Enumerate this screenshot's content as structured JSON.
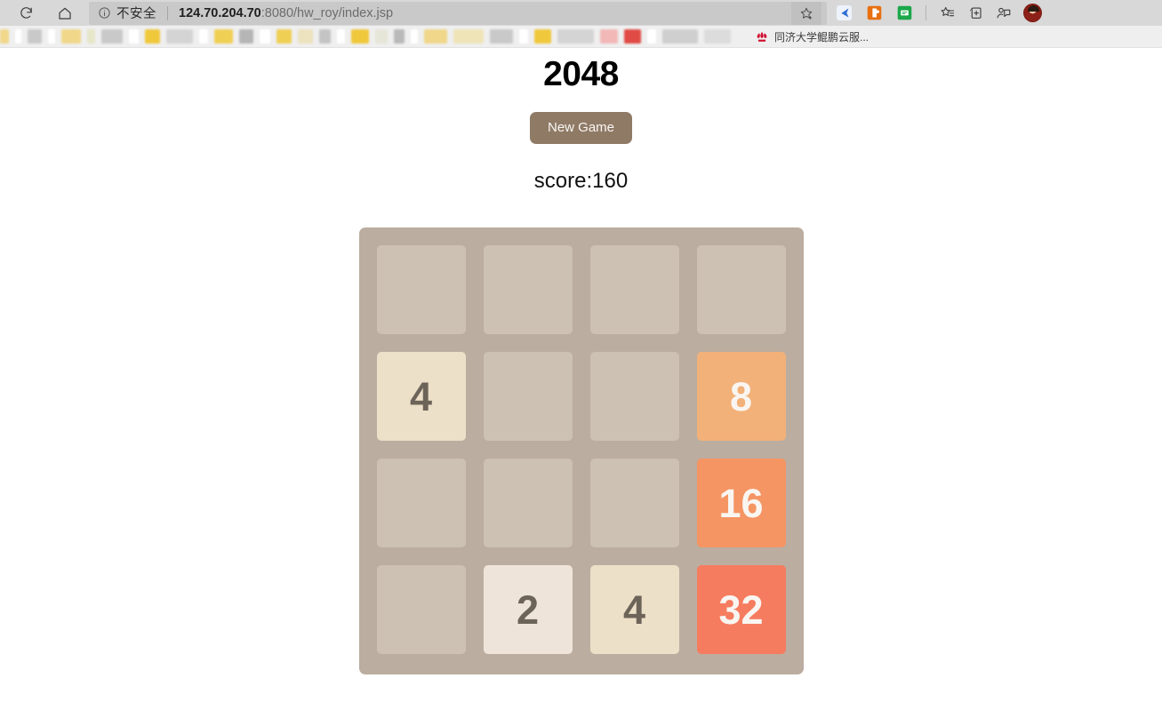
{
  "browser": {
    "reload_icon": "reload-icon",
    "home_icon": "home-icon",
    "info_icon": "info-circle-icon",
    "security_label": "不安全",
    "url_host": "124.70.204.70",
    "url_path": ":8080/hw_roy/index.jsp",
    "star_icon": "favorite-star-icon",
    "extensions": [
      {
        "name": "extension-blue-arrow",
        "color": "#2f6fd0",
        "bg": "#eef2fb"
      },
      {
        "name": "extension-orange-office",
        "color": "#e8700f",
        "bg": "#ffffff"
      },
      {
        "name": "extension-green-note",
        "color": "#1aa84a",
        "bg": "#ffffff"
      }
    ],
    "toolbar_icons": [
      {
        "name": "favorites-list-icon"
      },
      {
        "name": "collections-icon"
      },
      {
        "name": "feedback-icon"
      }
    ],
    "avatar_name": "profile-avatar"
  },
  "bookmarks": {
    "redacted": [
      {
        "w": 10,
        "c": "#f0d78a"
      },
      {
        "w": 7,
        "c": "#ffffff"
      },
      {
        "w": 16,
        "c": "#c9c9c9"
      },
      {
        "w": 8,
        "c": "#ffffff"
      },
      {
        "w": 22,
        "c": "#f0d78a"
      },
      {
        "w": 9,
        "c": "#e6e6c9"
      },
      {
        "w": 24,
        "c": "#c9c9c9"
      },
      {
        "w": 11,
        "c": "#ffffff"
      },
      {
        "w": 17,
        "c": "#f0c83c"
      },
      {
        "w": 30,
        "c": "#d4d4d4"
      },
      {
        "w": 10,
        "c": "#ffffff"
      },
      {
        "w": 21,
        "c": "#f0cf55"
      },
      {
        "w": 16,
        "c": "#b5b5b5"
      },
      {
        "w": 12,
        "c": "#ffffff"
      },
      {
        "w": 17,
        "c": "#f0cf55"
      },
      {
        "w": 17,
        "c": "#ece2bd"
      },
      {
        "w": 13,
        "c": "#c4c4c4"
      },
      {
        "w": 9,
        "c": "#ffffff"
      },
      {
        "w": 20,
        "c": "#f0c83c"
      },
      {
        "w": 14,
        "c": "#e6e6d8"
      },
      {
        "w": 12,
        "c": "#b9b9b9"
      },
      {
        "w": 8,
        "c": "#ffffff"
      },
      {
        "w": 26,
        "c": "#f0d78a"
      },
      {
        "w": 34,
        "c": "#efe4b8"
      },
      {
        "w": 26,
        "c": "#c9c9c9"
      },
      {
        "w": 10,
        "c": "#ffffff"
      },
      {
        "w": 19,
        "c": "#f0c83c"
      },
      {
        "w": 41,
        "c": "#d4d4d4"
      },
      {
        "w": 20,
        "c": "#f2b7b7"
      },
      {
        "w": 19,
        "c": "#e04b45"
      },
      {
        "w": 10,
        "c": "#ffffff"
      },
      {
        "w": 40,
        "c": "#cfcfcf"
      },
      {
        "w": 30,
        "c": "#dcdcdc"
      }
    ],
    "huawei_bookmark": {
      "icon": "huawei-logo-icon",
      "label": "同济大学鲲鹏云服..."
    }
  },
  "game": {
    "title": "2048",
    "new_game_label": "New Game",
    "score_label": "score:160",
    "score_value": 160,
    "board": [
      [
        null,
        null,
        null,
        null
      ],
      [
        4,
        null,
        null,
        8
      ],
      [
        null,
        null,
        null,
        16
      ],
      [
        null,
        2,
        4,
        32
      ]
    ],
    "tile_colors": {
      "empty": "#cdc1b4",
      "board_bg": "#bbada0",
      "2": {
        "bg": "#eee4da",
        "fg": "#6d6459"
      },
      "4": {
        "bg": "#ede0c8",
        "fg": "#6d6459"
      },
      "8": {
        "bg": "#f2b179",
        "fg": "#f9f6f2"
      },
      "16": {
        "bg": "#f59563",
        "fg": "#f9f6f2"
      },
      "32": {
        "bg": "#f67c5f",
        "fg": "#f9f6f2"
      }
    },
    "button_color": "#8f7a66"
  }
}
